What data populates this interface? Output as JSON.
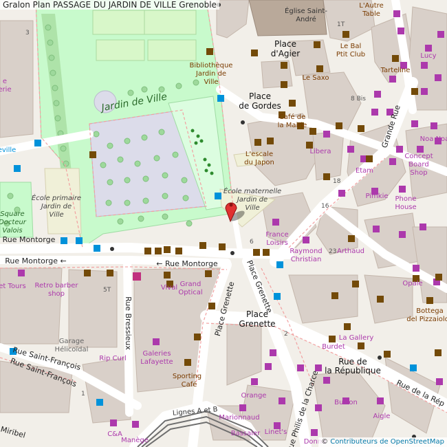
{
  "header": {
    "title": "Gralon Plan PASSAGE DU JARDIN DE VILLE Grenoble"
  },
  "attribution": {
    "prefix": "©",
    "link": "Contributeurs de OpenStreetMap"
  },
  "colors": {
    "background": "#f2efe9",
    "building": "#d9d0c9",
    "park": "#c8facc",
    "road": "#ffffff",
    "marker": "#e03131",
    "poi_purple": "#ac39ac",
    "poi_brown": "#734a08",
    "poi_blue": "#0092da"
  },
  "labels": {
    "jardin": "Jardin de Ville",
    "place_gordes_1": "Place",
    "place_gordes_2": "de Gordes",
    "place_agier_1": "Place",
    "place_agier_2": "d'Agier",
    "eglise_1": "Église Saint-",
    "eglise_2": "André",
    "biblio_1": "Bibliothèque",
    "biblio_2": "Jardin de",
    "biblio_3": "Ville",
    "ecole_mat_1": "École maternelle",
    "ecole_mat_2": "Jardin de",
    "ecole_mat_3": "Ville",
    "ecole_prim_1": "École primaire",
    "ecole_prim_2": "Jardin de",
    "ecole_prim_3": "Ville",
    "square_1": "Square",
    "square_2": "Docteur",
    "square_3": "Valois",
    "rue_montorge_a": "Rue Montorge",
    "rue_montorge_b": "Rue Montorge ←",
    "rue_montorge_c": "← Rue Montorge",
    "rue_bressieux": "Rue Bressieux",
    "place_grenette_v": "Place Grenette",
    "place_grenette_v2": "Place Grenette",
    "place_grenette_1": "Place",
    "place_grenette_2": "Grenette",
    "rue_republique_1": "Rue de",
    "rue_republique_2": "la République",
    "rue_republique_diag": "Rue de la Rép",
    "rue_st_francois_1": "Rue Saint-François",
    "rue_st_francois_2": "Rue Saint-François",
    "grande_rue": "Grande Rue",
    "rue_philis": "Rue Philis de la Charce",
    "lignes": "Lignes A et B",
    "mirabel": "Miribel",
    "garage_1": "Garage",
    "garage_2": "Hélicoïdal",
    "cafe_mairie_1": "Café de",
    "cafe_mairie_2": "la Mairie",
    "escale_1": "L'escale",
    "escale_2": "du Japon",
    "le_saxo": "Le Saxo",
    "le_bal_1": "Le Bal",
    "le_bal_2": "Ptit Club",
    "lautre_1": "L'Autre",
    "lautre_2": "Table",
    "tarteline": "Tarteline",
    "lucy": "Lucy",
    "libera": "Libera",
    "etam": "Etam",
    "pimkie": "Pimkie",
    "phone_house_1": "Phone",
    "phone_house_2": "House",
    "concept_1": "Concept",
    "concept_2": "Board",
    "concept_3": "Shop",
    "noa": "Noa Noa",
    "france_loisirs_1": "France",
    "france_loisirs_2": "Loisirs",
    "raymond_1": "Raymond",
    "raymond_2": "Christian",
    "arthaud": "Arthaud",
    "opale": "Opale",
    "bottega_1": "Bottega",
    "bottega_2": "del Pizzaiolo",
    "retro_1": "Retro barber",
    "retro_2": "shop",
    "et_tours": "et Tours",
    "vival": "Vival",
    "grand_optical_1": "Grand",
    "grand_optical_2": "Optical",
    "rip_curl": "Rip Curl",
    "galeries_1": "Galeries",
    "galeries_2": "Lafayette",
    "sporting_1": "Sporting",
    "sporting_2": "Café",
    "la_gallery": "La Gallery",
    "burdet": "Burdet",
    "orange": "Orange",
    "burton": "Burton",
    "aigle": "Aigle",
    "marionnaud": "Marionnaud",
    "bassaler": "Bassaler",
    "linets": "Linet's",
    "donna": "Donna",
    "manege": "Manège",
    "ca": "C&A",
    "num_3": "3",
    "num_8bis": "8 Bis",
    "num_18": "18",
    "num_16": "16",
    "num_23": "23",
    "num_6": "6",
    "num_5t": "5T",
    "num_1t": "1T",
    "num_2": "2",
    "num_1": "1",
    "frag_e": "e",
    "frag_erie": "erie",
    "frag_eville": "eville"
  }
}
